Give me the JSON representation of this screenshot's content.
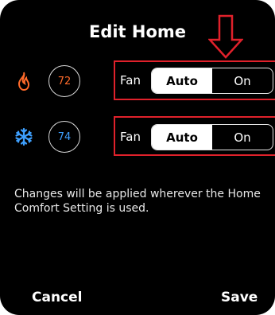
{
  "header": {
    "title": "Edit Home"
  },
  "rows": [
    {
      "mode": "heat",
      "icon": "flame-icon",
      "temp": "72",
      "fan_label": "Fan",
      "options": [
        "Auto",
        "On"
      ],
      "selected": "Auto"
    },
    {
      "mode": "cool",
      "icon": "snowflake-icon",
      "temp": "74",
      "fan_label": "Fan",
      "options": [
        "Auto",
        "On"
      ],
      "selected": "Auto"
    }
  ],
  "note": "Changes will be applied wherever the Home Comfort Setting is used.",
  "footer": {
    "cancel_label": "Cancel",
    "save_label": "Save"
  },
  "colors": {
    "heat": "#ff6a2a",
    "cool": "#3ea0ff",
    "annotation": "#e0212b",
    "background": "#000000"
  }
}
